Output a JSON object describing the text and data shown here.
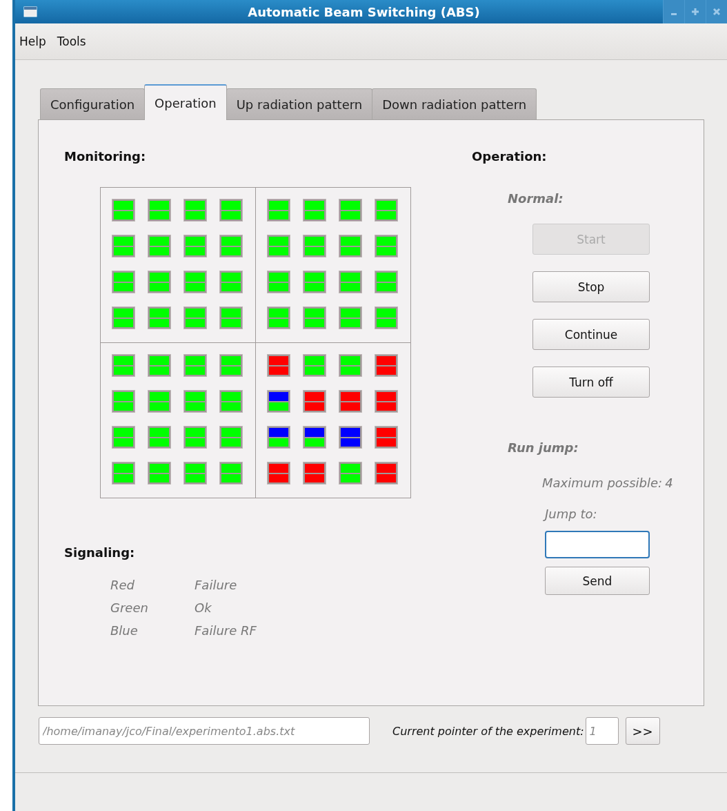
{
  "window": {
    "title": "Automatic Beam Switching (ABS)"
  },
  "menu": [
    "Help",
    "Tools"
  ],
  "tabs": [
    {
      "label": "Configuration",
      "selected": false
    },
    {
      "label": "Operation",
      "selected": true
    },
    {
      "label": "Up radiation pattern",
      "selected": false
    },
    {
      "label": "Down radiation pattern",
      "selected": false
    }
  ],
  "monitoring": {
    "title": "Monitoring:",
    "quadrants": [
      {
        "cells": [
          {
            "top": {
              "color": "#00ff00"
            },
            "bottom": {
              "color": "#00ff00"
            }
          },
          {
            "top": {
              "color": "#00ff00"
            },
            "bottom": {
              "color": "#00ff00"
            }
          },
          {
            "top": {
              "color": "#00ff00"
            },
            "bottom": {
              "color": "#00ff00"
            }
          },
          {
            "top": {
              "color": "#00ff00"
            },
            "bottom": {
              "color": "#00ff00"
            }
          },
          {
            "top": {
              "color": "#00ff00"
            },
            "bottom": {
              "color": "#00ff00"
            }
          },
          {
            "top": {
              "color": "#00ff00"
            },
            "bottom": {
              "color": "#00ff00"
            }
          },
          {
            "top": {
              "color": "#00ff00"
            },
            "bottom": {
              "color": "#00ff00"
            }
          },
          {
            "top": {
              "color": "#00ff00"
            },
            "bottom": {
              "color": "#00ff00"
            }
          },
          {
            "top": {
              "color": "#00ff00"
            },
            "bottom": {
              "color": "#00ff00"
            }
          },
          {
            "top": {
              "color": "#00ff00"
            },
            "bottom": {
              "color": "#00ff00"
            }
          },
          {
            "top": {
              "color": "#00ff00"
            },
            "bottom": {
              "color": "#00ff00"
            }
          },
          {
            "top": {
              "color": "#00ff00"
            },
            "bottom": {
              "color": "#00ff00"
            }
          },
          {
            "top": {
              "color": "#00ff00"
            },
            "bottom": {
              "color": "#00ff00"
            }
          },
          {
            "top": {
              "color": "#00ff00"
            },
            "bottom": {
              "color": "#00ff00"
            }
          },
          {
            "top": {
              "color": "#00ff00"
            },
            "bottom": {
              "color": "#00ff00"
            }
          },
          {
            "top": {
              "color": "#00ff00"
            },
            "bottom": {
              "color": "#00ff00"
            }
          }
        ]
      },
      {
        "cells": [
          {
            "top": {
              "color": "#00ff00"
            },
            "bottom": {
              "color": "#00ff00"
            }
          },
          {
            "top": {
              "color": "#00ff00"
            },
            "bottom": {
              "color": "#00ff00"
            }
          },
          {
            "top": {
              "color": "#00ff00"
            },
            "bottom": {
              "color": "#00ff00"
            }
          },
          {
            "top": {
              "color": "#00ff00"
            },
            "bottom": {
              "color": "#00ff00"
            }
          },
          {
            "top": {
              "color": "#00ff00"
            },
            "bottom": {
              "color": "#00ff00"
            }
          },
          {
            "top": {
              "color": "#00ff00"
            },
            "bottom": {
              "color": "#00ff00"
            }
          },
          {
            "top": {
              "color": "#00ff00"
            },
            "bottom": {
              "color": "#00ff00"
            }
          },
          {
            "top": {
              "color": "#00ff00"
            },
            "bottom": {
              "color": "#00ff00"
            }
          },
          {
            "top": {
              "color": "#00ff00"
            },
            "bottom": {
              "color": "#00ff00"
            }
          },
          {
            "top": {
              "color": "#00ff00"
            },
            "bottom": {
              "color": "#00ff00"
            }
          },
          {
            "top": {
              "color": "#00ff00"
            },
            "bottom": {
              "color": "#00ff00"
            }
          },
          {
            "top": {
              "color": "#00ff00"
            },
            "bottom": {
              "color": "#00ff00"
            }
          },
          {
            "top": {
              "color": "#00ff00"
            },
            "bottom": {
              "color": "#00ff00"
            }
          },
          {
            "top": {
              "color": "#00ff00"
            },
            "bottom": {
              "color": "#00ff00"
            }
          },
          {
            "top": {
              "color": "#00ff00"
            },
            "bottom": {
              "color": "#00ff00"
            }
          },
          {
            "top": {
              "color": "#00ff00"
            },
            "bottom": {
              "color": "#00ff00"
            }
          }
        ]
      },
      {
        "cells": [
          {
            "top": {
              "color": "#00ff00"
            },
            "bottom": {
              "color": "#00ff00"
            }
          },
          {
            "top": {
              "color": "#00ff00"
            },
            "bottom": {
              "color": "#00ff00"
            }
          },
          {
            "top": {
              "color": "#00ff00"
            },
            "bottom": {
              "color": "#00ff00"
            }
          },
          {
            "top": {
              "color": "#00ff00"
            },
            "bottom": {
              "color": "#00ff00"
            }
          },
          {
            "top": {
              "color": "#00ff00"
            },
            "bottom": {
              "color": "#00ff00"
            }
          },
          {
            "top": {
              "color": "#00ff00"
            },
            "bottom": {
              "color": "#00ff00"
            }
          },
          {
            "top": {
              "color": "#00ff00"
            },
            "bottom": {
              "color": "#00ff00"
            }
          },
          {
            "top": {
              "color": "#00ff00"
            },
            "bottom": {
              "color": "#00ff00"
            }
          },
          {
            "top": {
              "color": "#00ff00"
            },
            "bottom": {
              "color": "#00ff00"
            }
          },
          {
            "top": {
              "color": "#00ff00"
            },
            "bottom": {
              "color": "#00ff00"
            }
          },
          {
            "top": {
              "color": "#00ff00"
            },
            "bottom": {
              "color": "#00ff00"
            }
          },
          {
            "top": {
              "color": "#00ff00"
            },
            "bottom": {
              "color": "#00ff00"
            }
          },
          {
            "top": {
              "color": "#00ff00"
            },
            "bottom": {
              "color": "#00ff00"
            }
          },
          {
            "top": {
              "color": "#00ff00"
            },
            "bottom": {
              "color": "#00ff00"
            }
          },
          {
            "top": {
              "color": "#00ff00"
            },
            "bottom": {
              "color": "#00ff00"
            }
          },
          {
            "top": {
              "color": "#00ff00"
            },
            "bottom": {
              "color": "#00ff00"
            }
          }
        ]
      },
      {
        "cells": [
          {
            "top": {
              "color": "#ff0000"
            },
            "bottom": {
              "color": "#ff0000"
            }
          },
          {
            "top": {
              "color": "#00ff00"
            },
            "bottom": {
              "color": "#00ff00"
            }
          },
          {
            "top": {
              "color": "#00ff00"
            },
            "bottom": {
              "color": "#00ff00"
            }
          },
          {
            "top": {
              "color": "#ff0000"
            },
            "bottom": {
              "color": "#ff0000"
            }
          },
          {
            "top": {
              "color": "#0000ff"
            },
            "bottom": {
              "color": "#00ff00"
            }
          },
          {
            "top": {
              "color": "#ff0000"
            },
            "bottom": {
              "color": "#ff0000"
            }
          },
          {
            "top": {
              "color": "#ff0000"
            },
            "bottom": {
              "color": "#ff0000"
            }
          },
          {
            "top": {
              "color": "#ff0000"
            },
            "bottom": {
              "color": "#ff0000"
            }
          },
          {
            "top": {
              "color": "#0000ff"
            },
            "bottom": {
              "color": "#00ff00"
            }
          },
          {
            "top": {
              "color": "#0000ff"
            },
            "bottom": {
              "color": "#00ff00"
            }
          },
          {
            "top": {
              "color": "#0000ff"
            },
            "bottom": {
              "color": "#0000ff"
            }
          },
          {
            "top": {
              "color": "#ff0000"
            },
            "bottom": {
              "color": "#ff0000"
            }
          },
          {
            "top": {
              "color": "#ff0000"
            },
            "bottom": {
              "color": "#ff0000"
            }
          },
          {
            "top": {
              "color": "#ff0000"
            },
            "bottom": {
              "color": "#ff0000"
            }
          },
          {
            "top": {
              "color": "#00ff00"
            },
            "bottom": {
              "color": "#00ff00"
            }
          },
          {
            "top": {
              "color": "#ff0000"
            },
            "bottom": {
              "color": "#ff0000"
            }
          }
        ]
      }
    ]
  },
  "signaling": {
    "title": "Signaling:",
    "legend": [
      {
        "color_name": "Red",
        "meaning": "Failure"
      },
      {
        "color_name": "Green",
        "meaning": "Ok"
      },
      {
        "color_name": "Blue",
        "meaning": "Failure RF"
      }
    ]
  },
  "operation": {
    "title": "Operation:",
    "normal": {
      "title": "Normal:",
      "buttons": [
        {
          "label": "Start",
          "disabled": true
        },
        {
          "label": "Stop",
          "disabled": false
        },
        {
          "label": "Continue",
          "disabled": false
        },
        {
          "label": "Turn off",
          "disabled": false
        }
      ]
    },
    "run_jump": {
      "title": "Run jump:",
      "maximum_label": "Maximum possible:",
      "maximum_value": "4",
      "jump_label": "Jump to:",
      "send": "Send"
    }
  },
  "footer": {
    "file_path": "/home/imanay/jco/Final/experimento1.abs.txt",
    "pointer_label": "Current pointer of the experiment:",
    "pointer_value": "1",
    "next": ">>"
  }
}
